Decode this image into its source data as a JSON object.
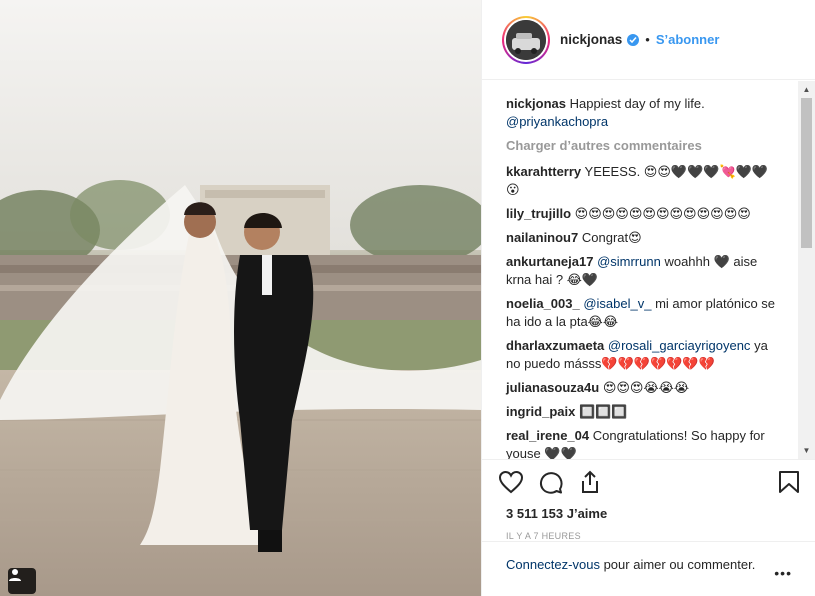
{
  "post": {
    "username": "nickjonas",
    "follow_label": "S’abonner",
    "separator": "•"
  },
  "caption": {
    "username": "nickjonas",
    "text": "Happiest day of my life.",
    "mention": "@priyankachopra"
  },
  "load_more_label": "Charger d’autres commentaires",
  "comments": [
    {
      "user": "kkarahtterry",
      "text": "YEEESS. 😍😍🖤🖤🖤💘🖤🖤😮"
    },
    {
      "user": "lily_trujillo",
      "text": "😍😍😍😍😍😍😍😍😍😍😍😍😍"
    },
    {
      "user": "nailaninou7",
      "text": "Congrat😍"
    },
    {
      "user": "ankurtaneja17",
      "mention": "@simrrunn",
      "text": "woahhh 🖤 aise krna hai ? 😂🖤"
    },
    {
      "user": "noelia_003_",
      "mention": "@isabel_v_",
      "text": "mi amor platónico se ha ido a la pta😂😂"
    },
    {
      "user": "dharlaxzumaeta",
      "mention": "@rosali_garciayrigoyenc",
      "text": "ya no puedo másss💔💔💔💔💔💔💔"
    },
    {
      "user": "julianasouza4u",
      "text": "😍😍😍😭😭😭"
    },
    {
      "user": "ingrid_paix",
      "text": "🔲🔲🔲"
    },
    {
      "user": "real_irene_04",
      "text": "Congratulations! So happy for youse 🖤🖤"
    }
  ],
  "likes_label": "3 511 153 J’aime",
  "timestamp": "IL Y A 7 HEURES",
  "footer": {
    "login_link": "Connectez-vous",
    "login_text": "pour aimer ou commenter.",
    "more": "•••"
  },
  "icons": {
    "like": "heart-icon",
    "comment": "comment-icon",
    "share": "share-icon",
    "save": "bookmark-icon",
    "verified": "verified-badge-icon",
    "user": "user-tag-icon"
  },
  "colors": {
    "link": "#3897f0",
    "mention": "#003569",
    "muted": "#999999"
  }
}
